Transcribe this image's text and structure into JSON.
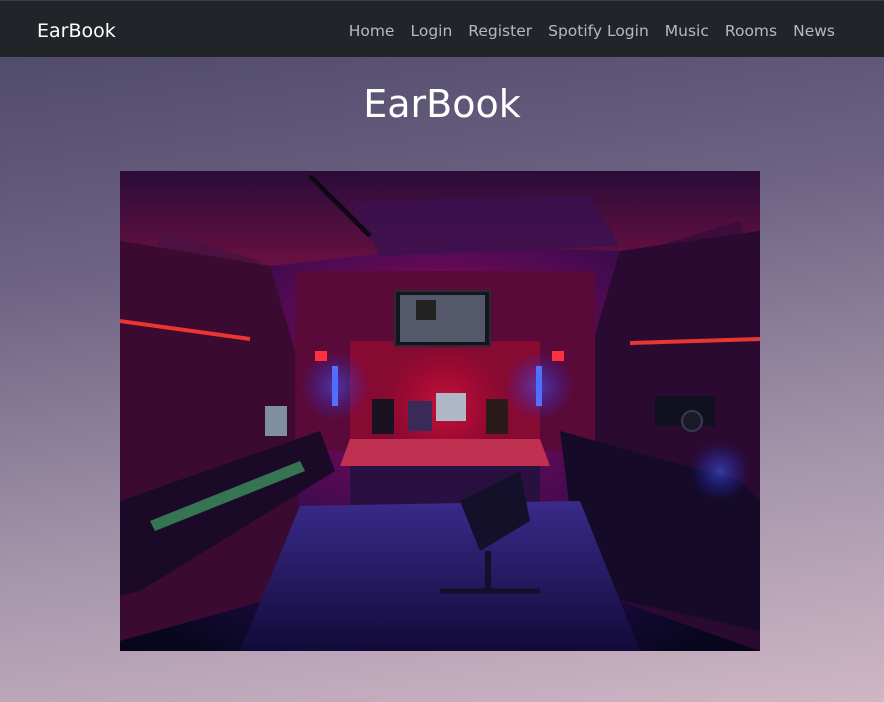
{
  "navbar": {
    "brand": "EarBook",
    "links": [
      {
        "label": "Home"
      },
      {
        "label": "Login"
      },
      {
        "label": "Register"
      },
      {
        "label": "Spotify Login"
      },
      {
        "label": "Music"
      },
      {
        "label": "Rooms"
      },
      {
        "label": "News"
      }
    ]
  },
  "main": {
    "title": "EarBook"
  },
  "colors": {
    "navbar_bg": "#212529",
    "nav_link": "#b6b9bd",
    "brand": "#ffffff"
  }
}
